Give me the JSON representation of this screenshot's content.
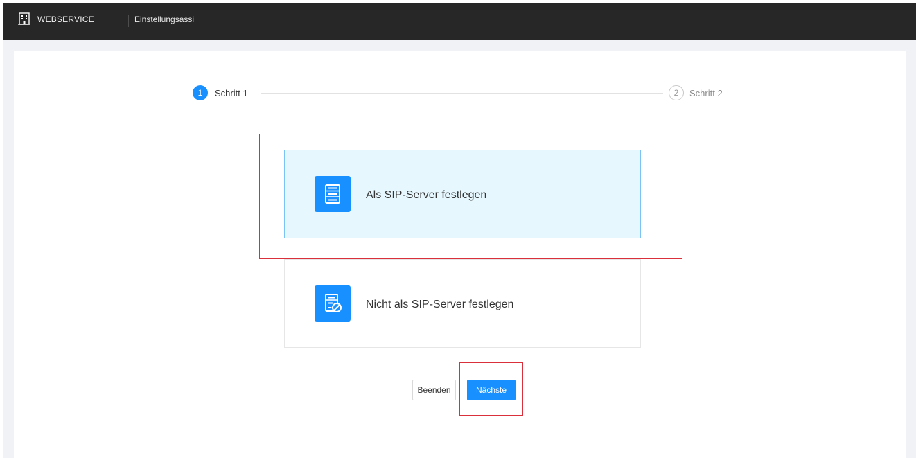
{
  "header": {
    "brand": "WEBSERVICE",
    "nav_title": "Einstellungsassi",
    "icon": "building-icon"
  },
  "steps": [
    {
      "number": "1",
      "label": "Schritt 1",
      "state": "active"
    },
    {
      "number": "2",
      "label": "Schritt 2",
      "state": "pending"
    }
  ],
  "options": [
    {
      "label": "Als SIP-Server festlegen",
      "icon": "server-icon",
      "selected": true
    },
    {
      "label": "Nicht als SIP-Server festlegen",
      "icon": "server-disabled-icon",
      "selected": false
    }
  ],
  "buttons": {
    "end_label": "Beenden",
    "next_label": "Nächste"
  },
  "colors": {
    "accent": "#1890ff",
    "topbar": "#272727",
    "highlight": "#d9303b",
    "selected_bg": "#e6f7fe"
  }
}
